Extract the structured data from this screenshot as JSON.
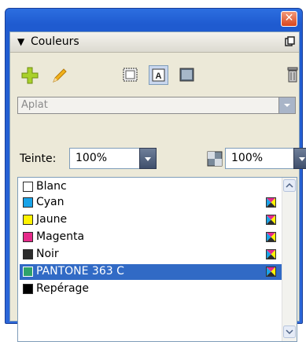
{
  "panel": {
    "title": "Couleurs",
    "colors": {
      "accent": "#2b66d8",
      "selection": "#316ac5"
    }
  },
  "toolbar": {
    "icons": [
      "add-swatch-icon",
      "edit-swatch-icon",
      "fill-icon",
      "text-icon",
      "stroke-icon",
      "trash-icon"
    ]
  },
  "fill_type": {
    "value": "Aplat"
  },
  "tint": {
    "label": "Teinte:",
    "value": "100%"
  },
  "opacity": {
    "value": "100%"
  },
  "swatches": [
    {
      "name": "Blanc",
      "color": "#ffffff",
      "process": false,
      "selected": false
    },
    {
      "name": "Cyan",
      "color": "#19a3e8",
      "process": true,
      "selected": false
    },
    {
      "name": "Jaune",
      "color": "#fff200",
      "process": true,
      "selected": false
    },
    {
      "name": "Magenta",
      "color": "#e52a8a",
      "process": true,
      "selected": false
    },
    {
      "name": "Noir",
      "color": "#2c2c2c",
      "process": true,
      "selected": false
    },
    {
      "name": "PANTONE 363 C",
      "color": "#2fa36b",
      "process": true,
      "selected": true
    },
    {
      "name": "Repérage",
      "color": "#000000",
      "process": false,
      "selected": false
    }
  ]
}
